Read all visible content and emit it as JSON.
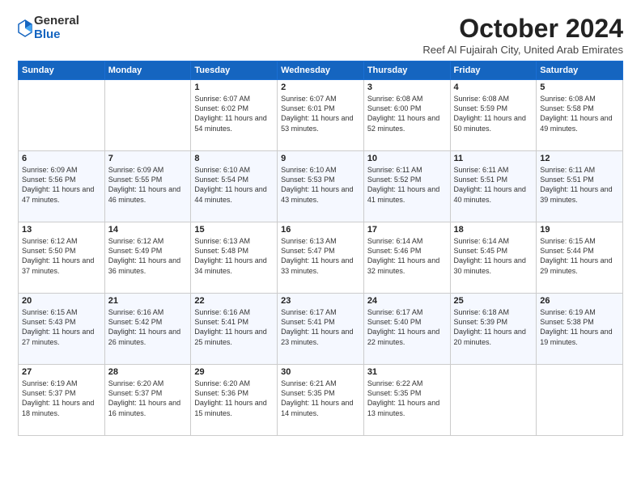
{
  "header": {
    "logo_general": "General",
    "logo_blue": "Blue",
    "month_title": "October 2024",
    "subtitle": "Reef Al Fujairah City, United Arab Emirates"
  },
  "days_of_week": [
    "Sunday",
    "Monday",
    "Tuesday",
    "Wednesday",
    "Thursday",
    "Friday",
    "Saturday"
  ],
  "weeks": [
    [
      {
        "day": "",
        "text": ""
      },
      {
        "day": "",
        "text": ""
      },
      {
        "day": "1",
        "text": "Sunrise: 6:07 AM\nSunset: 6:02 PM\nDaylight: 11 hours and 54 minutes."
      },
      {
        "day": "2",
        "text": "Sunrise: 6:07 AM\nSunset: 6:01 PM\nDaylight: 11 hours and 53 minutes."
      },
      {
        "day": "3",
        "text": "Sunrise: 6:08 AM\nSunset: 6:00 PM\nDaylight: 11 hours and 52 minutes."
      },
      {
        "day": "4",
        "text": "Sunrise: 6:08 AM\nSunset: 5:59 PM\nDaylight: 11 hours and 50 minutes."
      },
      {
        "day": "5",
        "text": "Sunrise: 6:08 AM\nSunset: 5:58 PM\nDaylight: 11 hours and 49 minutes."
      }
    ],
    [
      {
        "day": "6",
        "text": "Sunrise: 6:09 AM\nSunset: 5:56 PM\nDaylight: 11 hours and 47 minutes."
      },
      {
        "day": "7",
        "text": "Sunrise: 6:09 AM\nSunset: 5:55 PM\nDaylight: 11 hours and 46 minutes."
      },
      {
        "day": "8",
        "text": "Sunrise: 6:10 AM\nSunset: 5:54 PM\nDaylight: 11 hours and 44 minutes."
      },
      {
        "day": "9",
        "text": "Sunrise: 6:10 AM\nSunset: 5:53 PM\nDaylight: 11 hours and 43 minutes."
      },
      {
        "day": "10",
        "text": "Sunrise: 6:11 AM\nSunset: 5:52 PM\nDaylight: 11 hours and 41 minutes."
      },
      {
        "day": "11",
        "text": "Sunrise: 6:11 AM\nSunset: 5:51 PM\nDaylight: 11 hours and 40 minutes."
      },
      {
        "day": "12",
        "text": "Sunrise: 6:11 AM\nSunset: 5:51 PM\nDaylight: 11 hours and 39 minutes."
      }
    ],
    [
      {
        "day": "13",
        "text": "Sunrise: 6:12 AM\nSunset: 5:50 PM\nDaylight: 11 hours and 37 minutes."
      },
      {
        "day": "14",
        "text": "Sunrise: 6:12 AM\nSunset: 5:49 PM\nDaylight: 11 hours and 36 minutes."
      },
      {
        "day": "15",
        "text": "Sunrise: 6:13 AM\nSunset: 5:48 PM\nDaylight: 11 hours and 34 minutes."
      },
      {
        "day": "16",
        "text": "Sunrise: 6:13 AM\nSunset: 5:47 PM\nDaylight: 11 hours and 33 minutes."
      },
      {
        "day": "17",
        "text": "Sunrise: 6:14 AM\nSunset: 5:46 PM\nDaylight: 11 hours and 32 minutes."
      },
      {
        "day": "18",
        "text": "Sunrise: 6:14 AM\nSunset: 5:45 PM\nDaylight: 11 hours and 30 minutes."
      },
      {
        "day": "19",
        "text": "Sunrise: 6:15 AM\nSunset: 5:44 PM\nDaylight: 11 hours and 29 minutes."
      }
    ],
    [
      {
        "day": "20",
        "text": "Sunrise: 6:15 AM\nSunset: 5:43 PM\nDaylight: 11 hours and 27 minutes."
      },
      {
        "day": "21",
        "text": "Sunrise: 6:16 AM\nSunset: 5:42 PM\nDaylight: 11 hours and 26 minutes."
      },
      {
        "day": "22",
        "text": "Sunrise: 6:16 AM\nSunset: 5:41 PM\nDaylight: 11 hours and 25 minutes."
      },
      {
        "day": "23",
        "text": "Sunrise: 6:17 AM\nSunset: 5:41 PM\nDaylight: 11 hours and 23 minutes."
      },
      {
        "day": "24",
        "text": "Sunrise: 6:17 AM\nSunset: 5:40 PM\nDaylight: 11 hours and 22 minutes."
      },
      {
        "day": "25",
        "text": "Sunrise: 6:18 AM\nSunset: 5:39 PM\nDaylight: 11 hours and 20 minutes."
      },
      {
        "day": "26",
        "text": "Sunrise: 6:19 AM\nSunset: 5:38 PM\nDaylight: 11 hours and 19 minutes."
      }
    ],
    [
      {
        "day": "27",
        "text": "Sunrise: 6:19 AM\nSunset: 5:37 PM\nDaylight: 11 hours and 18 minutes."
      },
      {
        "day": "28",
        "text": "Sunrise: 6:20 AM\nSunset: 5:37 PM\nDaylight: 11 hours and 16 minutes."
      },
      {
        "day": "29",
        "text": "Sunrise: 6:20 AM\nSunset: 5:36 PM\nDaylight: 11 hours and 15 minutes."
      },
      {
        "day": "30",
        "text": "Sunrise: 6:21 AM\nSunset: 5:35 PM\nDaylight: 11 hours and 14 minutes."
      },
      {
        "day": "31",
        "text": "Sunrise: 6:22 AM\nSunset: 5:35 PM\nDaylight: 11 hours and 13 minutes."
      },
      {
        "day": "",
        "text": ""
      },
      {
        "day": "",
        "text": ""
      }
    ]
  ]
}
